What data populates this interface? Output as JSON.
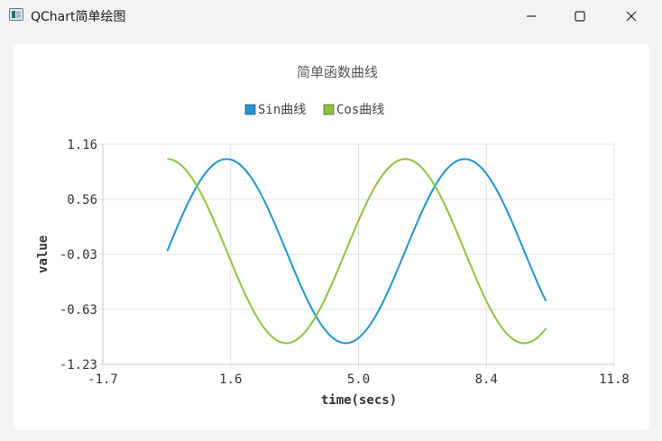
{
  "window": {
    "title": "QChart简单绘图",
    "icons": {
      "app": "chart-app-icon",
      "minimize": "minimize-icon",
      "maximize": "maximize-icon",
      "close": "close-icon"
    }
  },
  "colors": {
    "sin": "#1f96d0",
    "cos": "#8cc43c",
    "grid": "#e3e3e3",
    "axis": "#c8c8c8"
  },
  "chart_data": {
    "type": "line",
    "title": "简单函数曲线",
    "xlabel": "time(secs)",
    "ylabel": "value",
    "xlim": [
      -1.7,
      11.8
    ],
    "ylim": [
      -1.23,
      1.16
    ],
    "xticks": [
      "-1.7",
      "1.6",
      "5.0",
      "8.4",
      "11.8"
    ],
    "yticks": [
      "1.16",
      "0.56",
      "-0.03",
      "-0.63",
      "-1.23"
    ],
    "grid": true,
    "legend_position": "top-center",
    "x_range": [
      0,
      10
    ],
    "series": [
      {
        "name": "Sin曲线",
        "function": "sin",
        "color": "#1f96d0"
      },
      {
        "name": "Cos曲线",
        "function": "cos",
        "color": "#8cc43c"
      }
    ]
  }
}
